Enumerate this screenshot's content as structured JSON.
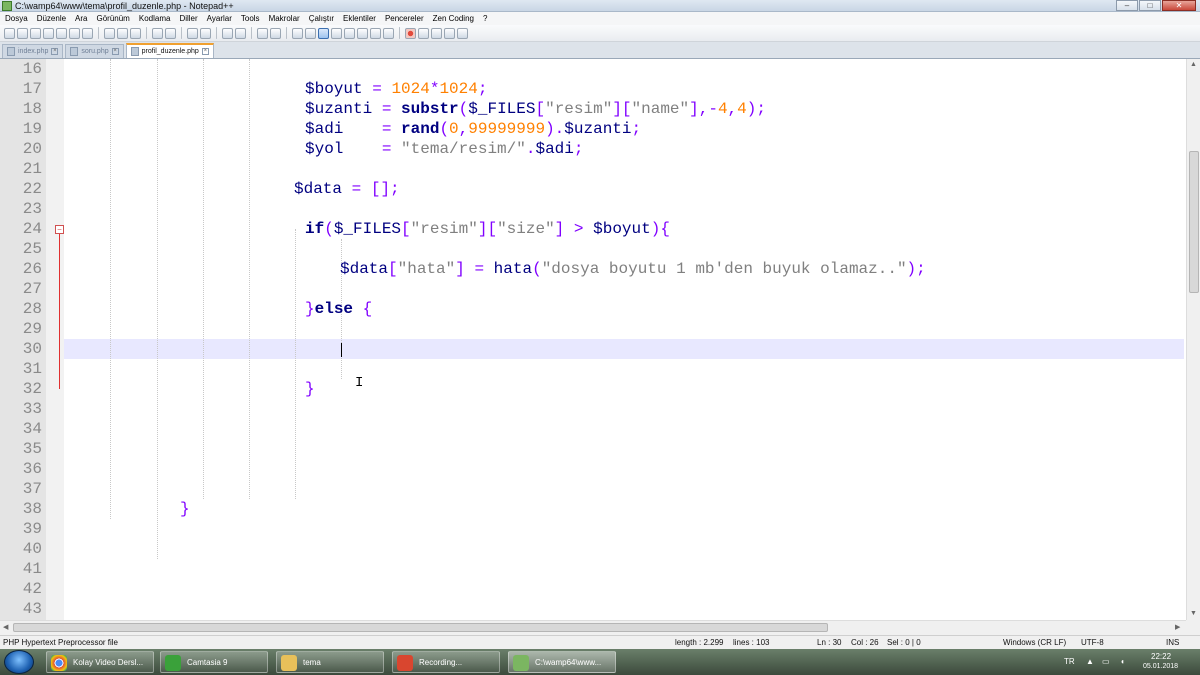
{
  "window": {
    "title": "C:\\wamp64\\www\\tema\\profil_duzenle.php - Notepad++",
    "buttons": [
      "–",
      "□",
      "✕"
    ]
  },
  "menu": [
    "Dosya",
    "Düzenle",
    "Ara",
    "Görünüm",
    "Kodlama",
    "Diller",
    "Ayarlar",
    "Tools",
    "Makrolar",
    "Çalıştır",
    "Eklentiler",
    "Pencereler",
    "Zen Coding",
    "?"
  ],
  "tabs": [
    {
      "label": "index.php",
      "active": false
    },
    {
      "label": "soru.php",
      "active": false
    },
    {
      "label": "profil_duzenle.php",
      "active": true
    }
  ],
  "editor": {
    "line_numbers": [
      "16",
      "17",
      "18",
      "19",
      "20",
      "21",
      "22",
      "23",
      "24",
      "25",
      "26",
      "27",
      "28",
      "29",
      "30",
      "31",
      "32",
      "33",
      "34",
      "35",
      "36",
      "37",
      "38",
      "39",
      "40",
      "41",
      "42",
      "43"
    ],
    "current_line": "30"
  },
  "status": {
    "filetype": "PHP Hypertext Preprocessor file",
    "length": "length : 2.299",
    "lines": "lines : 103",
    "ln": "Ln : 30",
    "col": "Col : 26",
    "sel": "Sel : 0 | 0",
    "eol": "Windows (CR LF)",
    "encoding": "UTF-8",
    "mode": "INS"
  },
  "taskbar": {
    "items": [
      {
        "label": "Kolay Video Dersl...",
        "icon": "chrome-icon",
        "color": "#dd4b39"
      },
      {
        "label": "Camtasia 9",
        "icon": "camtasia-icon",
        "color": "#3aa13a"
      },
      {
        "label": "tema",
        "icon": "folder-icon",
        "color": "#e8c05a"
      },
      {
        "label": "Recording...",
        "icon": "recording-icon",
        "color": "#d9462f"
      },
      {
        "label": "C:\\wamp64\\www...",
        "icon": "notepadpp-icon",
        "color": "#7bb661"
      }
    ],
    "lang": "TR",
    "time": "22:22",
    "date": "05.01.2018"
  }
}
